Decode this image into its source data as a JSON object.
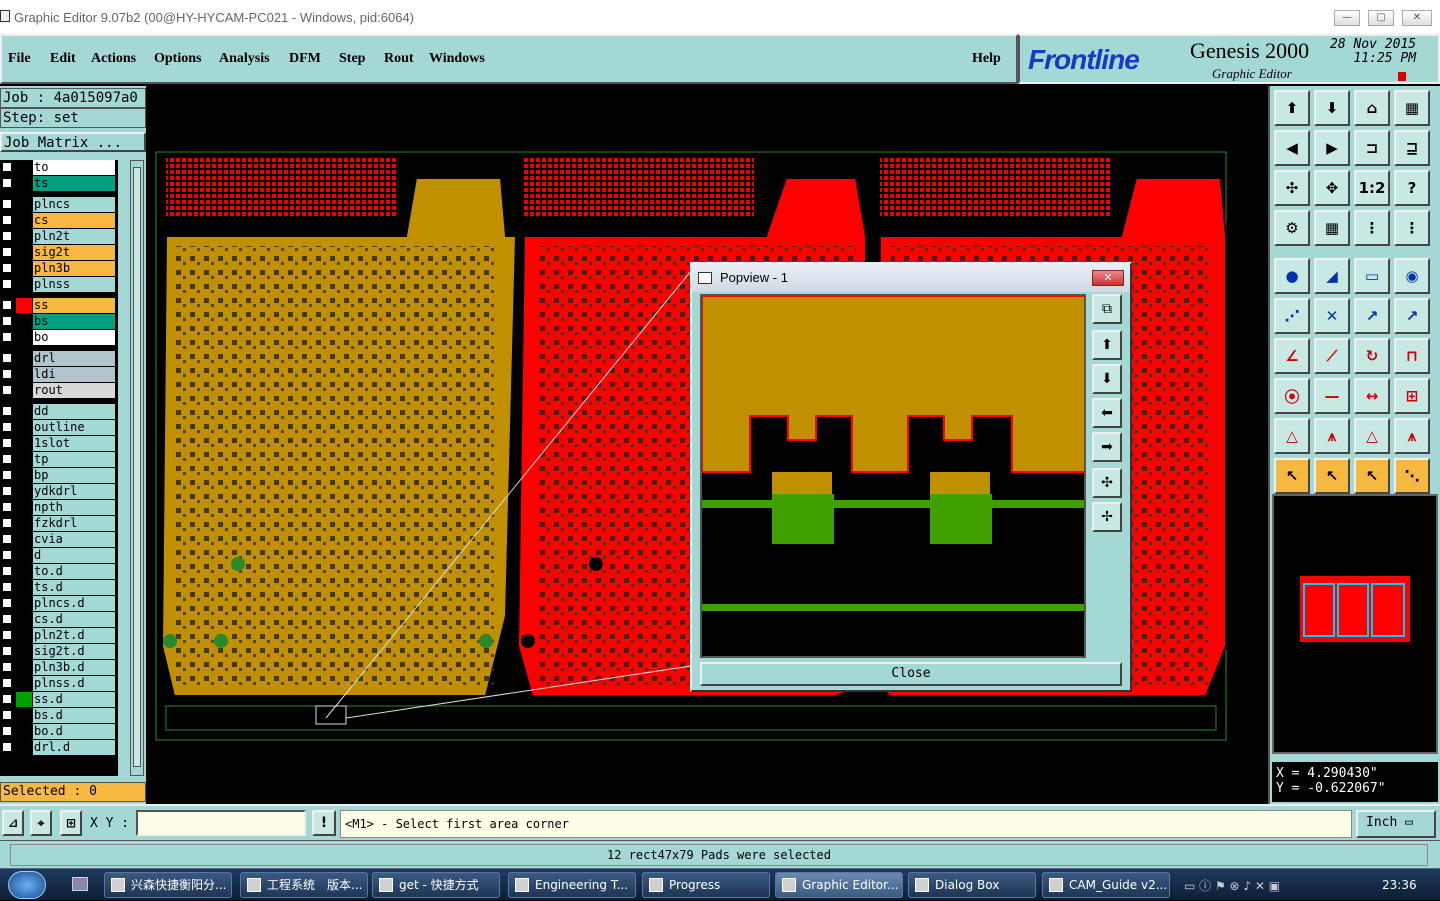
{
  "window": {
    "title": "Graphic Editor 9.07b2 (00@HY-HYCAM-PC021 - Windows, pid:6064)",
    "minimize": "—",
    "maximize": "▢",
    "close": "✕"
  },
  "menu": {
    "file": "File",
    "edit": "Edit",
    "actions": "Actions",
    "options": "Options",
    "analysis": "Analysis",
    "dfm": "DFM",
    "step": "Step",
    "rout": "Rout",
    "windows": "Windows",
    "help": "Help"
  },
  "brand": {
    "logo": "Frontline",
    "product": "Genesis 2000",
    "subtitle": "Graphic Editor",
    "date": "28 Nov 2015",
    "time": "11:25 PM"
  },
  "job": {
    "job_line": "Job : 4a015097a0",
    "step_line": "Step: set",
    "matrix_button": "Job Matrix ..."
  },
  "layers": [
    {
      "name": "to",
      "color": "#ffffff",
      "swatch": "#000000"
    },
    {
      "name": "ts",
      "color": "#00a080",
      "swatch": "#000000"
    },
    {
      "name": "plncs",
      "color": "#a4d8d4",
      "swatch": "#000000"
    },
    {
      "name": "cs",
      "color": "#f5b840",
      "swatch": "#000000"
    },
    {
      "name": "pln2t",
      "color": "#a4d8d4",
      "swatch": "#000000"
    },
    {
      "name": "sig2t",
      "color": "#f5b840",
      "swatch": "#000000"
    },
    {
      "name": "pln3b",
      "color": "#f5b840",
      "swatch": "#000000"
    },
    {
      "name": "plnss",
      "color": "#a4d8d4",
      "swatch": "#000000"
    },
    {
      "name": "ss",
      "color": "#f5b840",
      "swatch": "#ff0000"
    },
    {
      "name": "bs",
      "color": "#00a080",
      "swatch": "#000000"
    },
    {
      "name": "bo",
      "color": "#ffffff",
      "swatch": "#000000"
    },
    {
      "name": "drl",
      "color": "#b0c4cc",
      "swatch": "#000000"
    },
    {
      "name": "ldi",
      "color": "#b0c4cc",
      "swatch": "#000000"
    },
    {
      "name": "rout",
      "color": "#d8d8d8",
      "swatch": "#000000"
    },
    {
      "name": "dd",
      "color": "#a4d8d4",
      "swatch": "#000000"
    },
    {
      "name": "outline",
      "color": "#a4d8d4",
      "swatch": "#000000"
    },
    {
      "name": "1slot",
      "color": "#a4d8d4",
      "swatch": "#000000"
    },
    {
      "name": "tp",
      "color": "#a4d8d4",
      "swatch": "#000000"
    },
    {
      "name": "bp",
      "color": "#a4d8d4",
      "swatch": "#000000"
    },
    {
      "name": "ydkdrl",
      "color": "#a4d8d4",
      "swatch": "#000000"
    },
    {
      "name": "npth",
      "color": "#a4d8d4",
      "swatch": "#000000"
    },
    {
      "name": "fzkdrl",
      "color": "#a4d8d4",
      "swatch": "#000000"
    },
    {
      "name": "cvia",
      "color": "#a4d8d4",
      "swatch": "#000000"
    },
    {
      "name": "d",
      "color": "#a4d8d4",
      "swatch": "#000000"
    },
    {
      "name": "to.d",
      "color": "#a4d8d4",
      "swatch": "#000000"
    },
    {
      "name": "ts.d",
      "color": "#a4d8d4",
      "swatch": "#000000"
    },
    {
      "name": "plncs.d",
      "color": "#a4d8d4",
      "swatch": "#000000"
    },
    {
      "name": "cs.d",
      "color": "#a4d8d4",
      "swatch": "#000000"
    },
    {
      "name": "pln2t.d",
      "color": "#a4d8d4",
      "swatch": "#000000"
    },
    {
      "name": "sig2t.d",
      "color": "#a4d8d4",
      "swatch": "#000000"
    },
    {
      "name": "pln3b.d",
      "color": "#a4d8d4",
      "swatch": "#000000"
    },
    {
      "name": "plnss.d",
      "color": "#a4d8d4",
      "swatch": "#000000"
    },
    {
      "name": "ss.d",
      "color": "#a4d8d4",
      "swatch": "#00a000"
    },
    {
      "name": "bs.d",
      "color": "#a4d8d4",
      "swatch": "#000000"
    },
    {
      "name": "bo.d",
      "color": "#a4d8d4",
      "swatch": "#000000"
    },
    {
      "name": "drl.d",
      "color": "#a4d8d4",
      "swatch": "#000000"
    }
  ],
  "selected": "Selected : 0",
  "popview": {
    "title": "Popview - 1",
    "close_label": "Close"
  },
  "coords": {
    "x": "X = 4.290430\"",
    "y": "Y = -0.622067\""
  },
  "command": {
    "xy_label": "X Y :",
    "xy_value": "",
    "prompt": "<M1> - Select first area corner",
    "units": "Inch"
  },
  "status": "12 rect47x79 Pads were selected",
  "taskbar": {
    "items": [
      "兴森快捷衡阳分...",
      "工程系统　版本...",
      "get - 快捷方式",
      "Engineering T...",
      "Progress",
      "Graphic Editor...",
      "Dialog Box",
      "CAM_Guide v2..."
    ],
    "clock": "23:36"
  },
  "colors": {
    "panel": "#a4d8d4",
    "copper": "#c09000",
    "red": "#ff0000",
    "green": "#40a000"
  }
}
